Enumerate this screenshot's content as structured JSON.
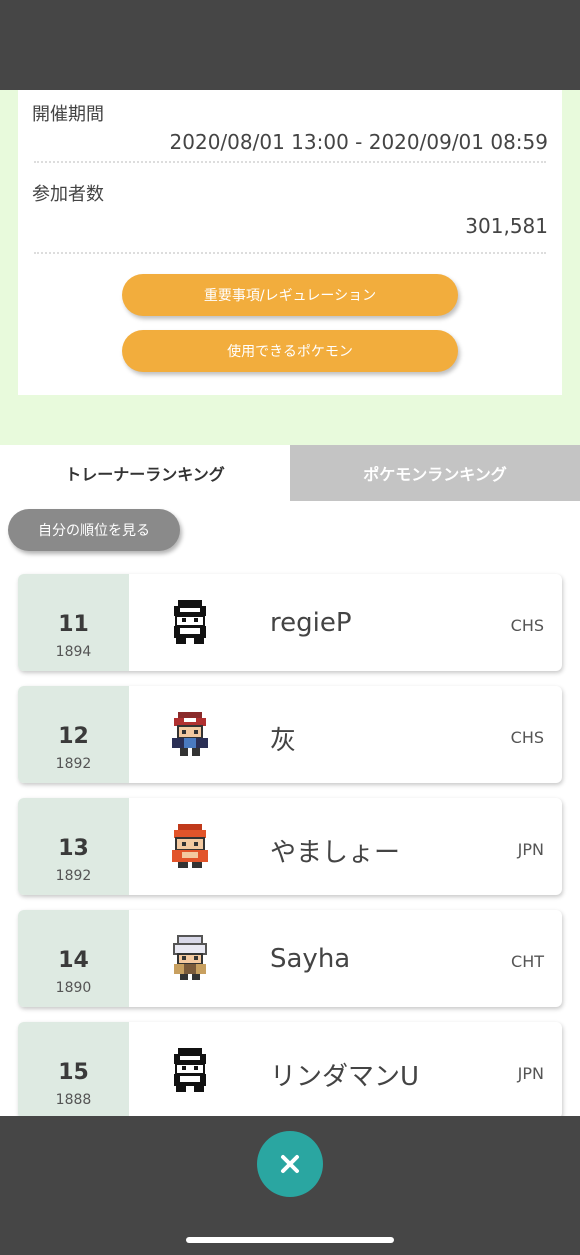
{
  "event": {
    "period_label": "開催期間",
    "period_value": "2020/08/01 13:00 - 2020/09/01 08:59",
    "participants_label": "参加者数",
    "participants_value": "301,581",
    "button_regulations": "重要事項/レギュレーション",
    "button_usable_pokemon": "使用できるポケモン"
  },
  "tabs": [
    {
      "label": "トレーナーランキング",
      "active": true
    },
    {
      "label": "ポケモンランキング",
      "active": false
    }
  ],
  "my_rank_button": "自分の順位を見る",
  "rankings": [
    {
      "rank": "11",
      "rating": "1894",
      "name": "regieP",
      "region": "CHS",
      "sprite": "black-cap-trainer-sprite"
    },
    {
      "rank": "12",
      "rating": "1892",
      "name": "灰",
      "region": "CHS",
      "sprite": "red-cap-trainer-sprite"
    },
    {
      "rank": "13",
      "rating": "1892",
      "name": "やましょー",
      "region": "JPN",
      "sprite": "orange-cap-trainer-sprite"
    },
    {
      "rank": "14",
      "rating": "1890",
      "name": "Sayha",
      "region": "CHT",
      "sprite": "white-hair-trainer-sprite"
    },
    {
      "rank": "15",
      "rating": "1888",
      "name": "リンダマンU",
      "region": "JPN",
      "sprite": "black-cap-trainer-sprite"
    }
  ],
  "footer": {
    "close_icon": "close-icon"
  },
  "colors": {
    "accent_orange": "#f2ad3d",
    "close_teal": "#2aa6a1",
    "rank_cell_bg": "#deeae2",
    "background_green": "#e8fadc",
    "bars_dark": "#464646"
  }
}
